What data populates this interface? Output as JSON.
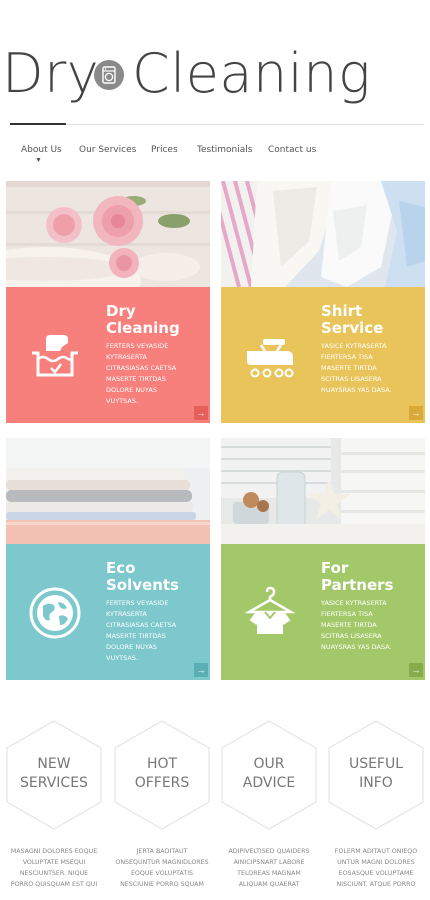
{
  "brand": {
    "word1": "Dry",
    "word2": "Cleaning"
  },
  "nav": {
    "items": [
      "About Us",
      "Our Services",
      "Prices",
      "Testimonials",
      "Contact us"
    ]
  },
  "cards": [
    {
      "title_line1": "Dry",
      "title_line2": "Cleaning",
      "lines": [
        "Ferters veyaside",
        "kytraserta",
        "citrasiasas caetsa",
        "maserte tirtdas",
        "dolore nuyas",
        "vuytsas."
      ],
      "color": "#f77f7c",
      "icon": "washing-hand-icon"
    },
    {
      "title_line1": "Shirt",
      "title_line2": "Service",
      "lines": [
        "Yasice kytraserta",
        "fiertersa tisa",
        "maserte tirtda",
        "scitras lisasera",
        "nuaysras yas dasa."
      ],
      "color": "#e9c45a",
      "icon": "shirt-iron-icon"
    },
    {
      "title_line1": "Eco",
      "title_line2": "Solvents",
      "lines": [
        "Ferters veyaside",
        "kytraserta",
        "citrasiasas caetsa",
        "maserte tirtdas",
        "dolore nuyas",
        "vuytsas."
      ],
      "color": "#7cc8cd",
      "icon": "globe-icon"
    },
    {
      "title_line1": "For",
      "title_line2": "Partners",
      "lines": [
        "Yasice kytraserta",
        "fiertersa tisa",
        "maserte tirtda",
        "scitras lisasera",
        "nuaysras yas dasa."
      ],
      "color": "#a3c86a",
      "icon": "hanger-shirt-icon"
    }
  ],
  "hexes": [
    {
      "line1": "NEW",
      "line2": "SERVICES"
    },
    {
      "line1": "HOT",
      "line2": "OFFERS"
    },
    {
      "line1": "OUR",
      "line2": "ADVICE"
    },
    {
      "line1": "USEFUL",
      "line2": "INFO"
    }
  ],
  "columns": [
    [
      "Masagni dolores eoque",
      "voluptate msequi",
      "nesciuntser. Nique",
      "porro quisquam est qui"
    ],
    [
      "Jerta baditaut",
      "onsequntur magnidlores",
      "eoque voluptatis",
      "nesciunie porro squam"
    ],
    [
      "Adipiveltised quaiders",
      "ainicipsnart labore",
      "teloreas magnam",
      "aliquam quaerat"
    ],
    [
      "Folerm aditaut onieqo",
      "untur magni dolores",
      "eosasque voluptame",
      "nisciunt. Atque porro"
    ]
  ]
}
